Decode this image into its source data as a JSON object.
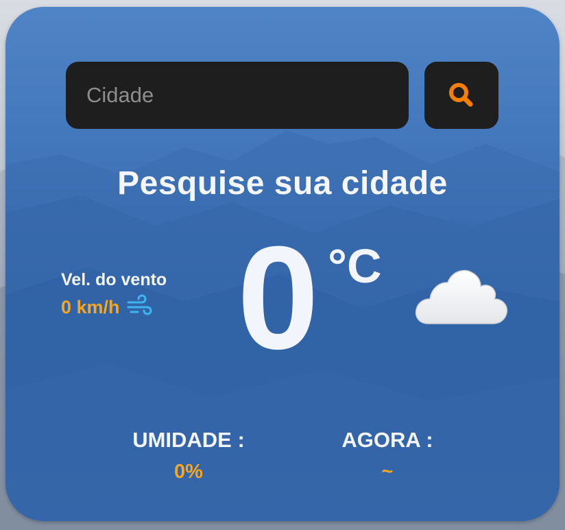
{
  "search": {
    "placeholder": "Cidade",
    "icon": "search-icon"
  },
  "title": "Pesquise sua cidade",
  "wind": {
    "label": "Vel. do vento",
    "value": "0 km/h",
    "icon": "wind-icon"
  },
  "temperature": {
    "value": "0",
    "unit": "°C"
  },
  "condition": {
    "icon": "cloud-icon"
  },
  "humidity": {
    "label": "UMIDADE :",
    "value": "0%"
  },
  "now": {
    "label": "AGORA :",
    "value": "~"
  },
  "colors": {
    "accent": "#f5a623",
    "search_icon": "#f77f00",
    "wind_icon": "#3fb6f0",
    "card": "#3f73b8",
    "input_bg": "#1e1e1e"
  }
}
